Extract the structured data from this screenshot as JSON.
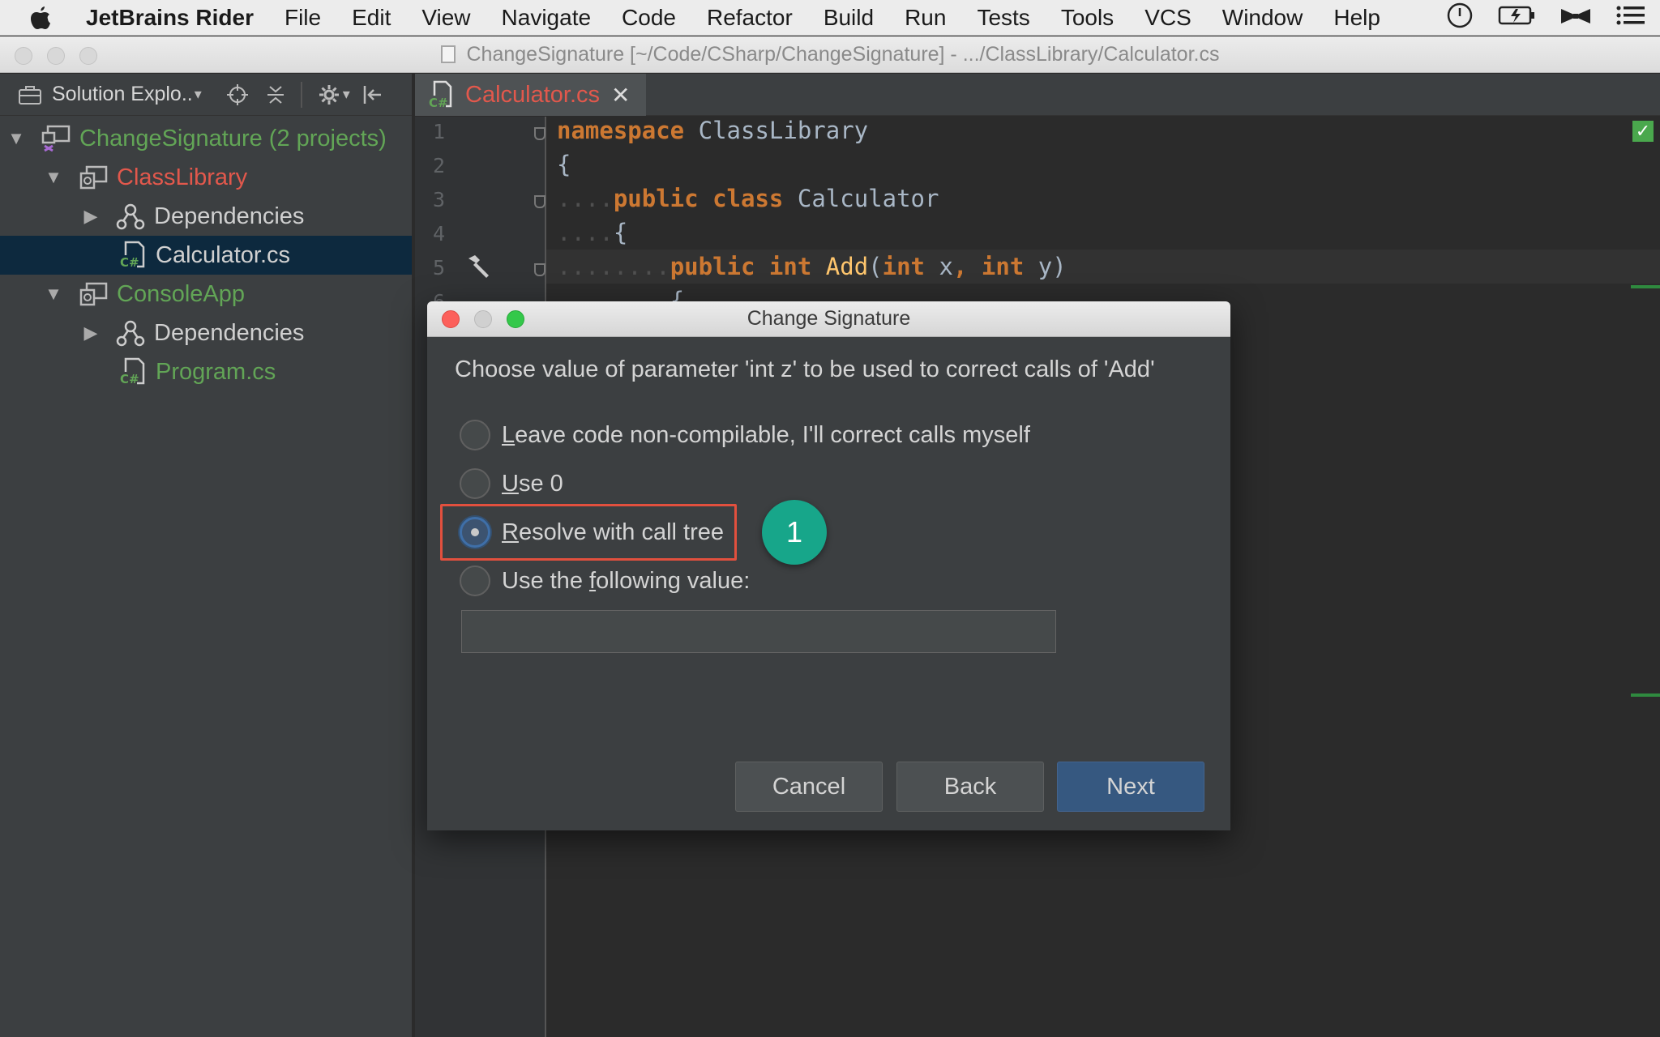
{
  "menubar": {
    "app_name": "JetBrains Rider",
    "items": [
      "File",
      "Edit",
      "View",
      "Navigate",
      "Code",
      "Refactor",
      "Build",
      "Run",
      "Tests",
      "Tools",
      "VCS",
      "Window",
      "Help"
    ]
  },
  "window": {
    "title": "ChangeSignature [~/Code/CSharp/ChangeSignature] - .../ClassLibrary/Calculator.cs"
  },
  "sidebar": {
    "panel_title": "Solution Explo..",
    "tree": [
      {
        "label": "ChangeSignature (2 projects)",
        "color": "#62a556"
      },
      {
        "label": "ClassLibrary",
        "color": "#e2584c"
      },
      {
        "label": "Dependencies",
        "color": "#d0d0d0"
      },
      {
        "label": "Calculator.cs",
        "color": "#d0d0d0"
      },
      {
        "label": "ConsoleApp",
        "color": "#62a556"
      },
      {
        "label": "Dependencies",
        "color": "#d0d0d0"
      },
      {
        "label": "Program.cs",
        "color": "#62a556"
      }
    ]
  },
  "editor": {
    "tab_label": "Calculator.cs",
    "line_numbers": [
      "1",
      "2",
      "3",
      "4",
      "5",
      "6"
    ],
    "code": {
      "l1_kw": "namespace",
      "l1_name": "ClassLibrary",
      "l2": "{",
      "l3_kw1": "public",
      "l3_kw2": "class",
      "l3_name": "Calculator",
      "l4": "{",
      "l5_kw1": "public",
      "l5_kw2": "int",
      "l5_method": "Add",
      "l5_open": "(",
      "l5_kw3": "int",
      "l5_p1": "x",
      "l5_comma": ",",
      "l5_kw4": "int",
      "l5_p2": "y",
      "l5_close": ")",
      "l6": "{"
    }
  },
  "dialog": {
    "title": "Change Signature",
    "question": "Choose value of parameter 'int z' to be used to correct calls of 'Add'",
    "options": [
      {
        "pre": "",
        "mnemonic": "L",
        "post": "eave code non-compilable, I'll correct calls myself",
        "checked": false
      },
      {
        "pre": "",
        "mnemonic": "U",
        "post": "se 0",
        "checked": false
      },
      {
        "pre": "",
        "mnemonic": "R",
        "post": "esolve with call tree",
        "checked": true
      },
      {
        "pre": "Use the ",
        "mnemonic": "f",
        "post": "ollowing value:",
        "checked": false
      }
    ],
    "value_input": "",
    "callout_number": "1",
    "buttons": {
      "cancel": "Cancel",
      "back": "Back",
      "next": "Next"
    }
  },
  "colors": {
    "accent": "#365880",
    "highlight": "#e2503e",
    "callout": "#17a68a",
    "keyword": "#cc7832",
    "method": "#ffc66d"
  }
}
